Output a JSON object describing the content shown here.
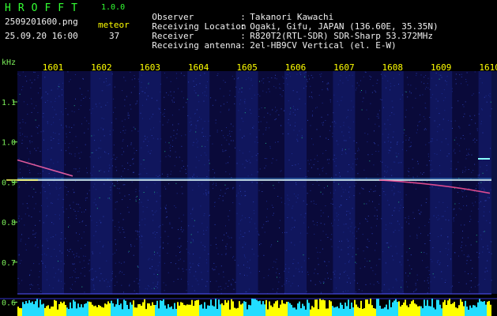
{
  "header": {
    "app_title": "HROFFT",
    "version": "1.0.0",
    "filename": "2509201600.png",
    "datetime": "25.09.20 16:00",
    "meteor_label": "meteor",
    "meteor_count": "37"
  },
  "info": [
    {
      "label": "Observer",
      "value": "Takanori Kawachi"
    },
    {
      "label": "Receiving Location",
      "value": "Ogaki, Gifu, JAPAN (136.60E, 35.35N)"
    },
    {
      "label": "Receiver",
      "value": "R820T2(RTL-SDR) SDR-Sharp 53.372MHz"
    },
    {
      "label": "Receiving antenna",
      "value": "2el-HB9CV Vertical (el. E-W)"
    }
  ],
  "info_separator": ":",
  "chart_data": {
    "type": "heatmap",
    "ylabel": "kHz",
    "y_ticks": [
      "1.1",
      "1.0",
      "0.9",
      "0.8",
      "0.7",
      "0.6"
    ],
    "y_tick_values": [
      1.1,
      1.0,
      0.9,
      0.8,
      0.7,
      0.6
    ],
    "ylim": [
      0.6,
      1.1
    ],
    "x_ticks": [
      "1601",
      "1602",
      "1603",
      "1604",
      "1605",
      "1606",
      "1607",
      "1608",
      "1609",
      "1610"
    ],
    "x_tick_values": [
      1601,
      1602,
      1603,
      1604,
      1605,
      1606,
      1607,
      1608,
      1609,
      1610
    ],
    "carrier_frequency_khz": 0.905,
    "meteor_count": 37,
    "colors": {
      "background": "#0a0a3a",
      "noise": "#1a2a8a",
      "carrier": "#e0ffff",
      "tick_text": "#ffff00",
      "axis_text": "#7cf05a",
      "baseline": "#5555ff",
      "bottom_bar_yellow": "#ffff00",
      "bottom_bar_cyan": "#22ddff"
    }
  }
}
